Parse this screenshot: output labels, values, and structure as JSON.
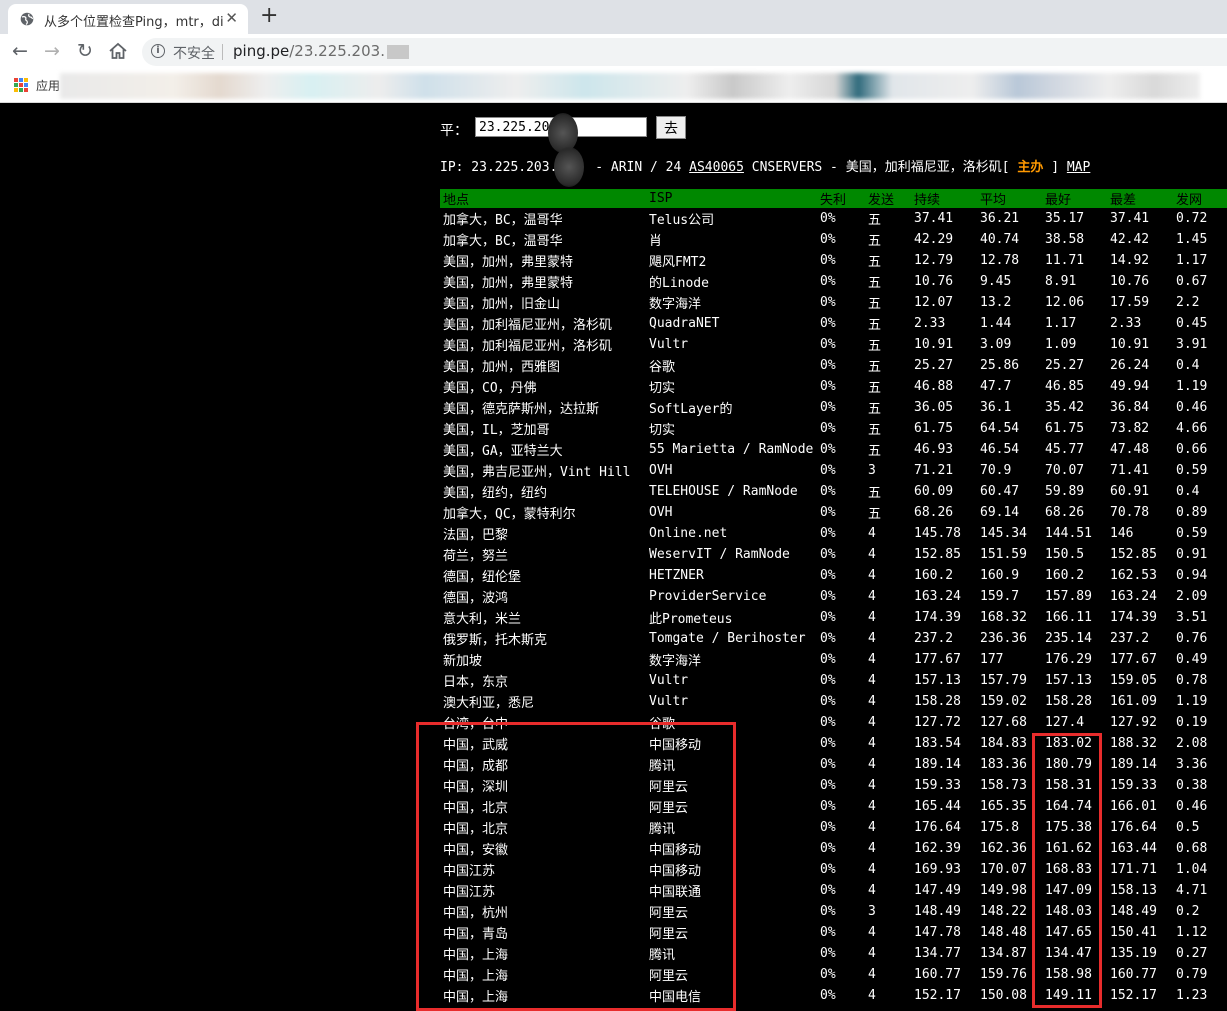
{
  "browser": {
    "tab_title": "从多个位置检查Ping，mtr，dig",
    "close_glyph": "✕",
    "newtab_glyph": "+",
    "insecure_label": "不安全",
    "url_host": "ping.pe",
    "url_path": "/23.225.203.",
    "bookmarks_label": "应用"
  },
  "form": {
    "label": "平：",
    "input_value": "23.225.203.",
    "go_label": "去"
  },
  "info": {
    "prefix": "IP: 23.225.203.",
    "mid": " - ARIN / 24 ",
    "asn": "AS40065",
    "rest": " CNSERVERS - 美国，加利福尼亚，洛杉矶[ ",
    "sponsor": "主办",
    "close": " ] ",
    "map": "MAP"
  },
  "table": {
    "headers": [
      "地点",
      "ISP",
      "失利",
      "发送",
      "持续",
      "平均",
      "最好",
      "最差",
      "发网"
    ],
    "rows": [
      [
        "加拿大，BC，温哥华",
        "Telus公司",
        "0%",
        "五",
        "37.41",
        "36.21",
        "35.17",
        "37.41",
        "0.72"
      ],
      [
        "加拿大，BC，温哥华",
        "肖",
        "0%",
        "五",
        "42.29",
        "40.74",
        "38.58",
        "42.42",
        "1.45"
      ],
      [
        "美国，加州，弗里蒙特",
        "飓风FMT2",
        "0%",
        "五",
        "12.79",
        "12.78",
        "11.71",
        "14.92",
        "1.17"
      ],
      [
        "美国，加州，弗里蒙特",
        "的Linode",
        "0%",
        "五",
        "10.76",
        "9.45",
        "8.91",
        "10.76",
        "0.67"
      ],
      [
        "美国，加州，旧金山",
        "数字海洋",
        "0%",
        "五",
        "12.07",
        "13.2",
        "12.06",
        "17.59",
        "2.2"
      ],
      [
        "美国，加利福尼亚州，洛杉矶",
        "QuadraNET",
        "0%",
        "五",
        "2.33",
        "1.44",
        "1.17",
        "2.33",
        "0.45"
      ],
      [
        "美国，加利福尼亚州，洛杉矶",
        "Vultr",
        "0%",
        "五",
        "10.91",
        "3.09",
        "1.09",
        "10.91",
        "3.91"
      ],
      [
        "美国，加州，西雅图",
        "谷歌",
        "0%",
        "五",
        "25.27",
        "25.86",
        "25.27",
        "26.24",
        "0.4"
      ],
      [
        "美国，CO，丹佛",
        "切实",
        "0%",
        "五",
        "46.88",
        "47.7",
        "46.85",
        "49.94",
        "1.19"
      ],
      [
        "美国，德克萨斯州，达拉斯",
        "SoftLayer的",
        "0%",
        "五",
        "36.05",
        "36.1",
        "35.42",
        "36.84",
        "0.46"
      ],
      [
        "美国，IL，芝加哥",
        "切实",
        "0%",
        "五",
        "61.75",
        "64.54",
        "61.75",
        "73.82",
        "4.66"
      ],
      [
        "美国，GA，亚特兰大",
        "55 Marietta / RamNode",
        "0%",
        "五",
        "46.93",
        "46.54",
        "45.77",
        "47.48",
        "0.66"
      ],
      [
        "美国，弗吉尼亚州，Vint Hill",
        "OVH",
        "0%",
        "3",
        "71.21",
        "70.9",
        "70.07",
        "71.41",
        "0.59"
      ],
      [
        "美国，纽约，纽约",
        "TELEHOUSE / RamNode",
        "0%",
        "五",
        "60.09",
        "60.47",
        "59.89",
        "60.91",
        "0.4"
      ],
      [
        "加拿大，QC，蒙特利尔",
        "OVH",
        "0%",
        "五",
        "68.26",
        "69.14",
        "68.26",
        "70.78",
        "0.89"
      ],
      [
        "法国，巴黎",
        "Online.net",
        "0%",
        "4",
        "145.78",
        "145.34",
        "144.51",
        "146",
        "0.59"
      ],
      [
        "荷兰，努兰",
        "WeservIT / RamNode",
        "0%",
        "4",
        "152.85",
        "151.59",
        "150.5",
        "152.85",
        "0.91"
      ],
      [
        "德国，纽伦堡",
        "HETZNER",
        "0%",
        "4",
        "160.2",
        "160.9",
        "160.2",
        "162.53",
        "0.94"
      ],
      [
        "德国，波鸿",
        "ProviderService",
        "0%",
        "4",
        "163.24",
        "159.7",
        "157.89",
        "163.24",
        "2.09"
      ],
      [
        "意大利，米兰",
        "此Prometeus",
        "0%",
        "4",
        "174.39",
        "168.32",
        "166.11",
        "174.39",
        "3.51"
      ],
      [
        "俄罗斯，托木斯克",
        "Tomgate / Berihoster",
        "0%",
        "4",
        "237.2",
        "236.36",
        "235.14",
        "237.2",
        "0.76"
      ],
      [
        "新加坡",
        "数字海洋",
        "0%",
        "4",
        "177.67",
        "177",
        "176.29",
        "177.67",
        "0.49"
      ],
      [
        "日本，东京",
        "Vultr",
        "0%",
        "4",
        "157.13",
        "157.79",
        "157.13",
        "159.05",
        "0.78"
      ],
      [
        "澳大利亚，悉尼",
        "Vultr",
        "0%",
        "4",
        "158.28",
        "159.02",
        "158.28",
        "161.09",
        "1.19"
      ],
      [
        "台湾，台中",
        "谷歌",
        "0%",
        "4",
        "127.72",
        "127.68",
        "127.4",
        "127.92",
        "0.19"
      ],
      [
        "中国，武威",
        "中国移动",
        "0%",
        "4",
        "183.54",
        "184.83",
        "183.02",
        "188.32",
        "2.08"
      ],
      [
        "中国，成都",
        "腾讯",
        "0%",
        "4",
        "189.14",
        "183.36",
        "180.79",
        "189.14",
        "3.36"
      ],
      [
        "中国，深圳",
        "阿里云",
        "0%",
        "4",
        "159.33",
        "158.73",
        "158.31",
        "159.33",
        "0.38"
      ],
      [
        "中国，北京",
        "阿里云",
        "0%",
        "4",
        "165.44",
        "165.35",
        "164.74",
        "166.01",
        "0.46"
      ],
      [
        "中国，北京",
        "腾讯",
        "0%",
        "4",
        "176.64",
        "175.8",
        "175.38",
        "176.64",
        "0.5"
      ],
      [
        "中国，安徽",
        "中国移动",
        "0%",
        "4",
        "162.39",
        "162.36",
        "161.62",
        "163.44",
        "0.68"
      ],
      [
        "中国江苏",
        "中国移动",
        "0%",
        "4",
        "169.93",
        "170.07",
        "168.83",
        "171.71",
        "1.04"
      ],
      [
        "中国江苏",
        "中国联通",
        "0%",
        "4",
        "147.49",
        "149.98",
        "147.09",
        "158.13",
        "4.71"
      ],
      [
        "中国，杭州",
        "阿里云",
        "0%",
        "3",
        "148.49",
        "148.22",
        "148.03",
        "148.49",
        "0.2"
      ],
      [
        "中国，青岛",
        "阿里云",
        "0%",
        "4",
        "147.78",
        "148.48",
        "147.65",
        "150.41",
        "1.12"
      ],
      [
        "中国，上海",
        "腾讯",
        "0%",
        "4",
        "134.77",
        "134.87",
        "134.47",
        "135.19",
        "0.27"
      ],
      [
        "中国，上海",
        "阿里云",
        "0%",
        "4",
        "160.77",
        "159.76",
        "158.98",
        "160.77",
        "0.79"
      ],
      [
        "中国，上海",
        "中国电信",
        "0%",
        "4",
        "152.17",
        "150.08",
        "149.11",
        "152.17",
        "1.23"
      ]
    ]
  },
  "colors": {
    "header_bg": "#008800",
    "highlight_box": "#e82c2c",
    "sponsor": "#ff9900",
    "page_bg": "#000000"
  }
}
